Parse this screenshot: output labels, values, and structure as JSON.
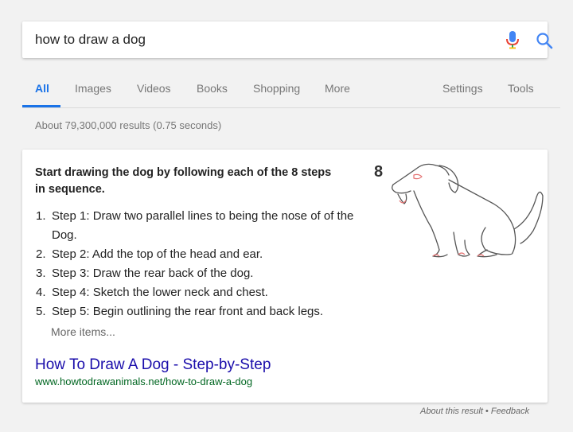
{
  "search": {
    "query": "how to draw a dog"
  },
  "tabs": {
    "items": [
      {
        "id": "all",
        "label": "All"
      },
      {
        "id": "images",
        "label": "Images"
      },
      {
        "id": "videos",
        "label": "Videos"
      },
      {
        "id": "books",
        "label": "Books"
      },
      {
        "id": "shopping",
        "label": "Shopping"
      },
      {
        "id": "more",
        "label": "More"
      }
    ],
    "settings": "Settings",
    "tools": "Tools",
    "active": "all"
  },
  "stats": {
    "results_count": "About 79,300,000 results (0.75 seconds)"
  },
  "snippet": {
    "heading": "Start drawing the dog by following each of the 8 steps in sequence.",
    "steps": [
      {
        "num": "1.",
        "text": "Step 1: Draw two parallel lines to being the nose of of the Dog."
      },
      {
        "num": "2.",
        "text": "Step 2: Add the top of the head and ear."
      },
      {
        "num": "3.",
        "text": "Step 3: Draw the rear back of the dog."
      },
      {
        "num": "4.",
        "text": "Step 4: Sketch the lower neck and chest."
      },
      {
        "num": "5.",
        "text": "Step 5: Begin outlining the rear front and back legs."
      }
    ],
    "more_items": "More items...",
    "image_step_number": "8",
    "result_title": "How To Draw A Dog - Step-by-Step",
    "result_url": "www.howtodrawanimals.net/how-to-draw-a-dog"
  },
  "footer": {
    "about": "About this result",
    "separator": " • ",
    "feedback": "Feedback"
  },
  "colors": {
    "link": "#1a0dab",
    "url": "#006621",
    "accent": "#1a73e8",
    "mic_red": "#ea4335"
  },
  "icons": {
    "mic": "microphone-icon",
    "search": "search-icon"
  }
}
